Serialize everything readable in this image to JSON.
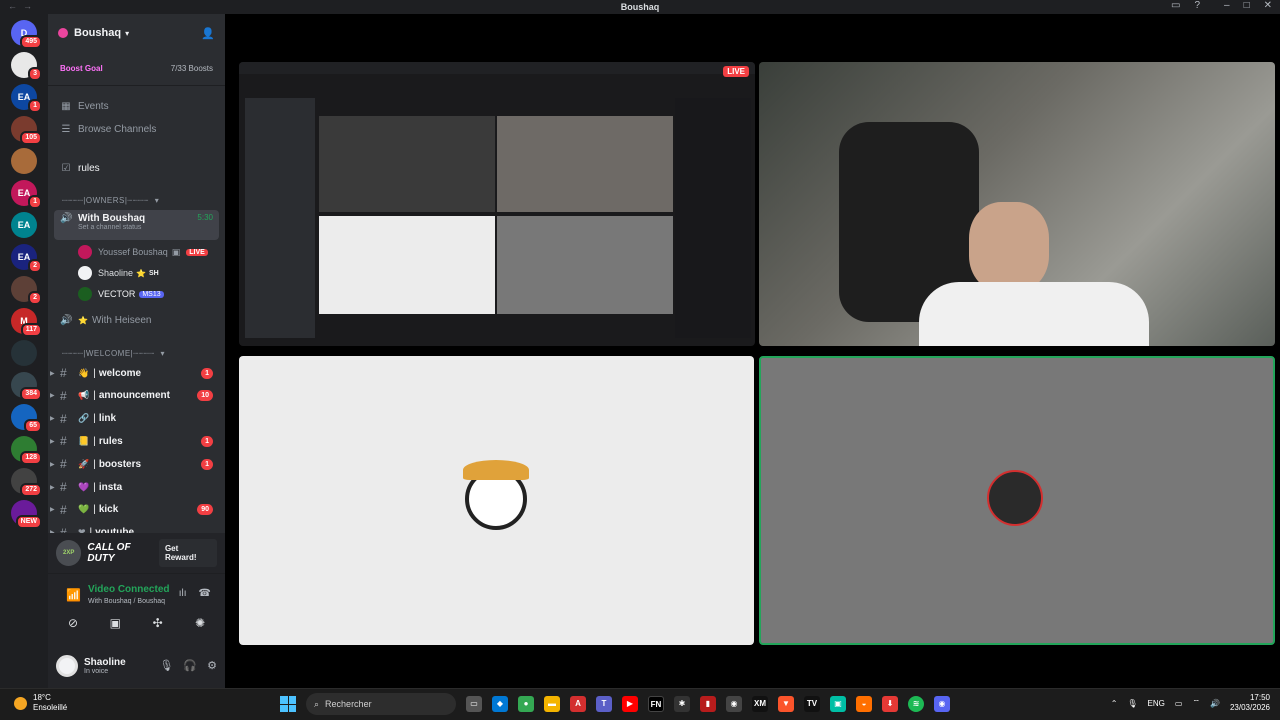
{
  "window": {
    "title": "Boushaq"
  },
  "server": {
    "name": "Boushaq",
    "boost_goal": "Boost Goal",
    "boost_count": "7/33 Boosts"
  },
  "guilds": [
    {
      "label": "D",
      "badge": "495",
      "color": "#5865f2"
    },
    {
      "label": "",
      "badge": "3",
      "color": "#e8e8e8"
    },
    {
      "label": "EA",
      "badge": "1",
      "color": "#0d47a1"
    },
    {
      "label": "",
      "badge": "105",
      "color": "#7a3b2e"
    },
    {
      "label": "",
      "badge": "",
      "color": "#a86b3a"
    },
    {
      "label": "EA",
      "badge": "1",
      "color": "#c2185b"
    },
    {
      "label": "EA",
      "badge": "",
      "color": "#00838f"
    },
    {
      "label": "EA",
      "badge": "2",
      "color": "#1a237e"
    },
    {
      "label": "",
      "badge": "2",
      "color": "#5d4037"
    },
    {
      "label": "M",
      "badge": "117",
      "color": "#c62828"
    },
    {
      "label": "",
      "badge": "",
      "color": "#263238"
    },
    {
      "label": "",
      "badge": "384",
      "color": "#37474f"
    },
    {
      "label": "",
      "badge": "65",
      "color": "#1565c0"
    },
    {
      "label": "",
      "badge": "128",
      "color": "#2e7d32"
    },
    {
      "label": "",
      "badge": "272",
      "color": "#424242"
    },
    {
      "label": "",
      "badge": "NEW",
      "color": "#6a1b9a"
    }
  ],
  "nav": {
    "events": "Events",
    "browse": "Browse Channels",
    "rules": "rules"
  },
  "categories": {
    "owners": "┈┈┈┈|OWNERS|┈┈┈┈",
    "welcome": "┈┈┈┈|WELCOME|┈┈┈┈"
  },
  "voice": {
    "channel_main": "With Boushaq",
    "channel_time": "5:30",
    "channel_status": "Set a channel status",
    "users": [
      {
        "name": "Youssef Boushaq",
        "extra": "LIVE"
      },
      {
        "name": "Shaoline",
        "extra": "SH"
      },
      {
        "name": "VECTOR",
        "extra": "MS13"
      }
    ],
    "channel_other": "With Heiseen"
  },
  "channels": [
    {
      "emoji": "👋",
      "name": "welcome",
      "badge": "1"
    },
    {
      "emoji": "📢",
      "name": "announcement",
      "badge": "10"
    },
    {
      "emoji": "🔗",
      "name": "link",
      "badge": ""
    },
    {
      "emoji": "📒",
      "name": "rules",
      "badge": "1"
    },
    {
      "emoji": "🚀",
      "name": "boosters",
      "badge": "1"
    },
    {
      "emoji": "💜",
      "name": "insta",
      "badge": ""
    },
    {
      "emoji": "💚",
      "name": "kick",
      "badge": "90"
    },
    {
      "emoji": "❤",
      "name": "youtube",
      "badge": ""
    }
  ],
  "promo": {
    "xp": "2XP",
    "logo": "CALL OF DUTY",
    "button": "Get Reward!"
  },
  "voice_panel": {
    "status": "Video Connected",
    "sub": "With Boushaq / Boushaq"
  },
  "user": {
    "name": "Shaoline",
    "status": "In voice"
  },
  "stage": {
    "live": "LIVE"
  },
  "taskbar": {
    "temp": "18°C",
    "weather": "Ensoleillé",
    "search": "Rechercher",
    "lang": "ENG",
    "time": "17:50",
    "date": "23/03/2026"
  },
  "colors": {
    "accent": "#5865f2",
    "live": "#f23f43",
    "connected": "#23a55a"
  }
}
